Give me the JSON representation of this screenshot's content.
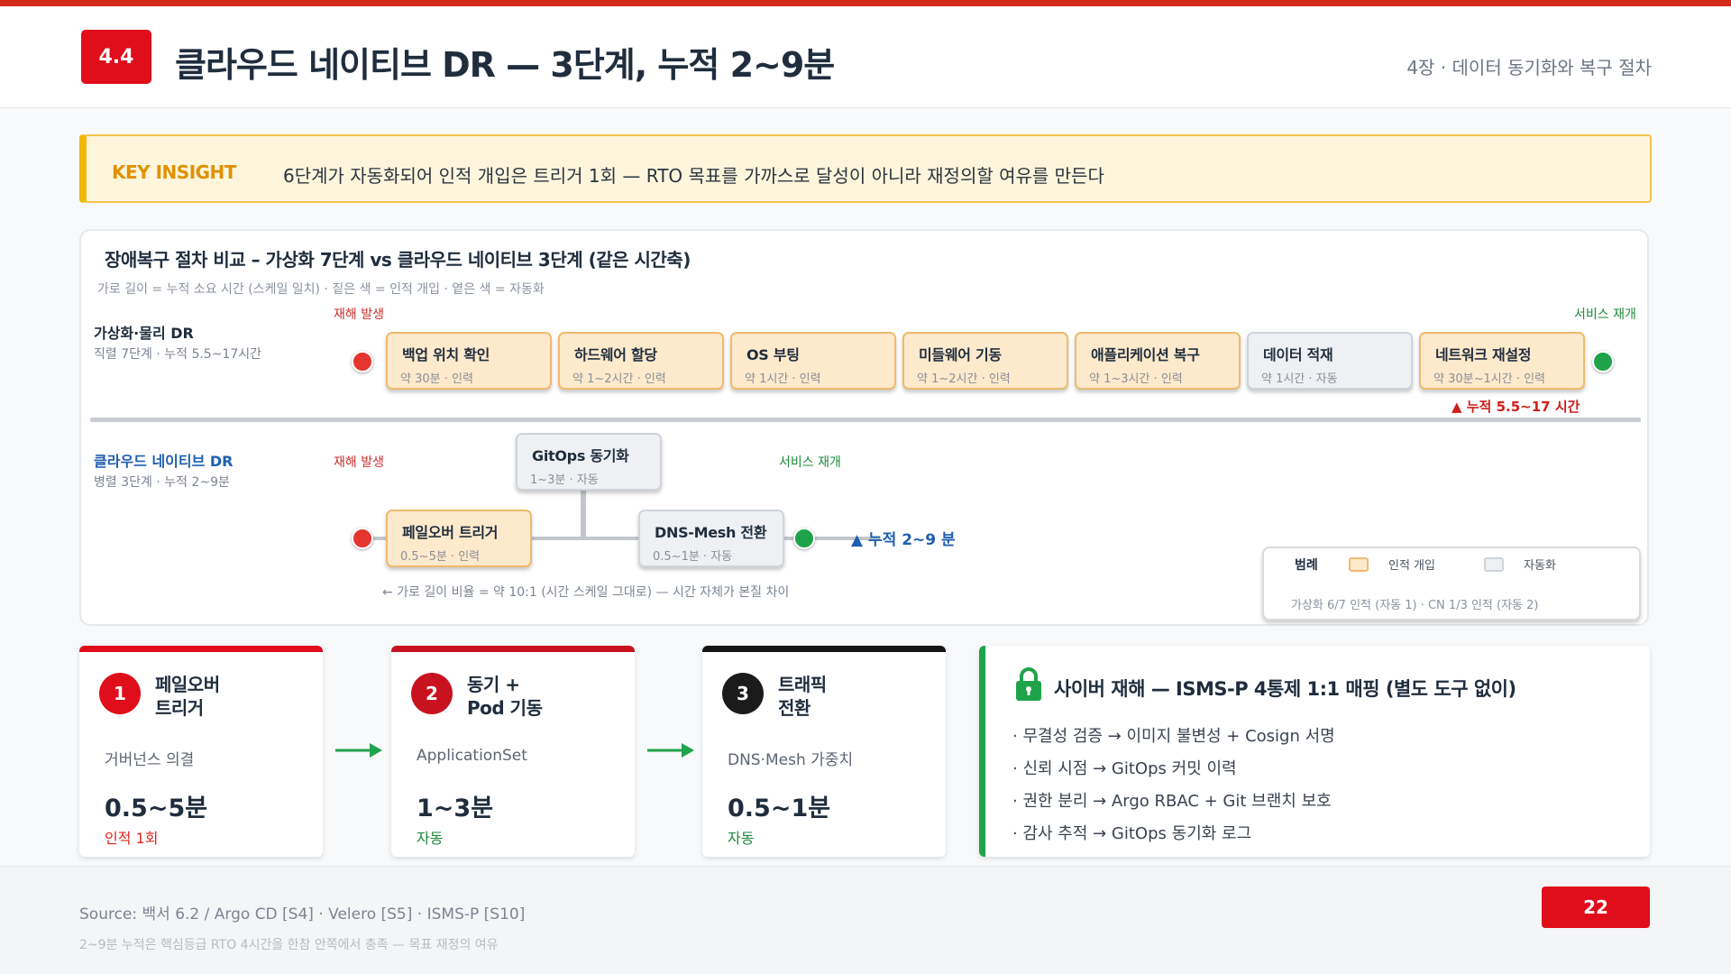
{
  "header": {
    "section": "4.4",
    "title": "클라우드 네이티브 DR — 3단계, 누적 2~9분",
    "chapter": "4장 · 데이터 동기화와 복구 절차"
  },
  "insight": {
    "label": "KEY INSIGHT",
    "text": "6단계가 자동화되어 인적 개입은 트리거 1회 — RTO 목표를 가까스로 달성이 아니라 재정의할 여유를 만든다"
  },
  "diagram": {
    "title": "장애복구 절차 비교 – 가상화 7단계 vs 클라우드 네이티브 3단계 (같은 시간축)",
    "subtitle": "가로 길이 = 누적 소요 시간 (스케일 일치) · 짙은 색 = 인적 개입 · 옅은 색 = 자동화",
    "virtual": {
      "name": "가상화·물리 DR",
      "desc": "직렬 7단계 · 누적 5.5~17시간",
      "start_tag": "재해 발생",
      "end_tag": "서비스 재개",
      "steps": [
        {
          "name": "백업 위치 확인",
          "time": "약 30분 · 인력",
          "mode": "human"
        },
        {
          "name": "하드웨어 할당",
          "time": "약 1~2시간 · 인력",
          "mode": "human"
        },
        {
          "name": "OS 부팅",
          "time": "약 1시간 · 인력",
          "mode": "human"
        },
        {
          "name": "미들웨어 기동",
          "time": "약 1~2시간 · 인력",
          "mode": "human"
        },
        {
          "name": "애플리케이션 복구",
          "time": "약 1~3시간 · 인력",
          "mode": "human"
        },
        {
          "name": "데이터 적재",
          "time": "약 1시간 · 자동",
          "mode": "auto"
        },
        {
          "name": "네트워크 재설정",
          "time": "약 30분~1시간 · 인력",
          "mode": "human"
        }
      ],
      "cumulative": "▲ 누적 5.5~17 시간"
    },
    "cloud": {
      "name": "클라우드 네이티브 DR",
      "desc": "병렬 3단계 · 누적 2~9분",
      "start_tag": "재해 발생",
      "end_tag": "서비스 재개",
      "steps": [
        {
          "name": "페일오버 트리거",
          "time": "0.5~5분 · 인력",
          "mode": "human"
        },
        {
          "name": "GitOps 동기화",
          "time": "1~3분 · 자동",
          "mode": "auto"
        },
        {
          "name": "DNS-Mesh 전환",
          "time": "0.5~1분 · 자동",
          "mode": "auto"
        }
      ],
      "cumulative": "▲ 누적 2~9 분",
      "ratio_note": "← 가로 길이 비율 = 약 10:1 (시간 스케일 그대로) — 시간 자체가 본질 차이"
    },
    "legend": {
      "title": "범례",
      "human_label": "인적 개입",
      "auto_label": "자동화",
      "summary": "가상화 6/7 인적 (자동 1) · CN 1/3 인적 (자동 2)"
    },
    "colors": {
      "human_fill": "#fde9cc",
      "human_border": "#f1ba6e",
      "auto_fill": "#eef0f3",
      "auto_border": "#cfd4da",
      "start_dot": "#e4362f",
      "end_dot": "#1fa34a"
    }
  },
  "cards": [
    {
      "number": "1",
      "title_l1": "페일오버",
      "title_l2": "트리거",
      "sub": "거버넌스 의결",
      "duration": "0.5~5분",
      "mode": "인적 1회",
      "bar_color": "#e00d1a",
      "num_color": "#e00d1a",
      "mode_color": "#e0261d"
    },
    {
      "number": "2",
      "title_l1": "동기 +",
      "title_l2": "Pod 기동",
      "sub": "ApplicationSet",
      "duration": "1~3분",
      "mode": "자동",
      "bar_color": "#c8121f",
      "num_color": "#c8121f",
      "mode_color": "#1e8a3a"
    },
    {
      "number": "3",
      "title_l1": "트래픽",
      "title_l2": "전환",
      "sub": "DNS·Mesh 가중치",
      "duration": "0.5~1분",
      "mode": "자동",
      "bar_color": "#141414",
      "num_color": "#1b1b1b",
      "mode_color": "#1e8a3a"
    }
  ],
  "isms": {
    "icon": "lock-icon",
    "title": "사이버 재해 — ISMS-P 4통제 1:1 매핑 (별도 도구 없이)",
    "items": [
      "· 무결성 검증 → 이미지 불변성 + Cosign 서명",
      "· 신뢰 시점 → GitOps 커밋 이력",
      "· 권한 분리 → Argo RBAC + Git 브랜치 보호",
      "· 감사 추적 → GitOps 동기화 로그"
    ],
    "accent": "#1fa34a"
  },
  "footer": {
    "source": "Source: 백서 6.2 / Argo CD [S4] · Velero [S5] · ISMS-P [S10]",
    "note": "2~9분 누적은 핵심등급 RTO 4시간을 한참 안쪽에서 충족 — 목표 재정의 여유",
    "page": "22"
  }
}
